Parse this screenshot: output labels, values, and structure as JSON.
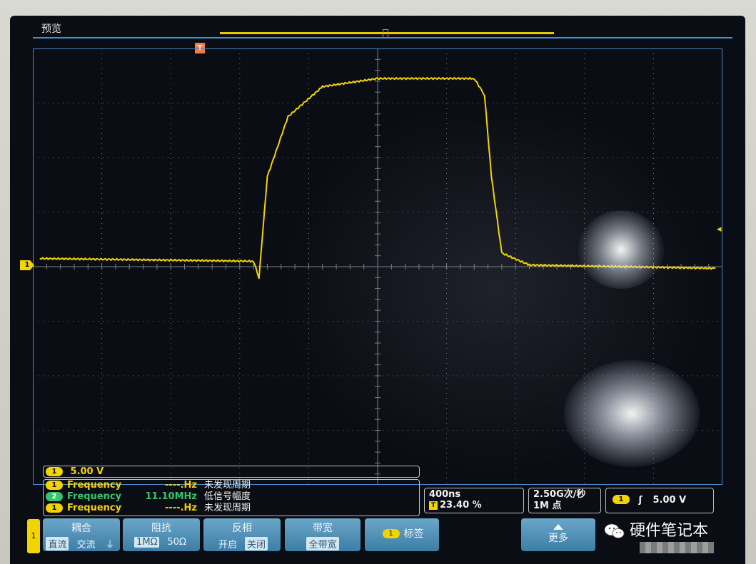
{
  "screen": {
    "title": "预览"
  },
  "markers": {
    "trigger_position": "T",
    "channel1": "1"
  },
  "scale_readout": {
    "channel": "1",
    "value": "5.00 V"
  },
  "measurements": [
    {
      "channel": "1",
      "name": "Frequency",
      "value": "----.Hz",
      "note": "未发现周期",
      "color": "#f2d400"
    },
    {
      "channel": "2",
      "name": "Frequency",
      "value": "11.10MHz",
      "note": "低信号幅度",
      "color": "#37c36a"
    },
    {
      "channel": "1",
      "name": "Frequency",
      "value": "----.Hz",
      "note": "未发现周期",
      "color": "#f2d400"
    }
  ],
  "timebase": {
    "per_div": "400ns",
    "trigger_icon": "T",
    "trigger_position": "23.40 %"
  },
  "sample": {
    "rate": "2.50G次/秒",
    "record_length": "1M 点"
  },
  "trigger": {
    "channel": "1",
    "slope_icon": "rising-edge-icon",
    "slope_glyph": "ʃ",
    "level": "5.00 V"
  },
  "softkeys": {
    "side_tab": "1",
    "coupling": {
      "title": "耦合",
      "opt1": "直流",
      "opt2": "交流",
      "opt3": "⏚"
    },
    "impedance": {
      "title": "阻抗",
      "opt1": "1MΩ",
      "opt2": "50Ω"
    },
    "invert": {
      "title": "反相",
      "opt1": "开启",
      "opt2": "关闭"
    },
    "bandwidth": {
      "title": "带宽",
      "opt1": "全带宽"
    },
    "label": {
      "badge": "1",
      "title": "标签"
    },
    "more": {
      "title": "更多"
    }
  },
  "watermark": {
    "text": "硬件笔记本"
  },
  "colors": {
    "trace": "#f2d400",
    "channel2": "#37c36a",
    "graticule": "#4a86c8",
    "softkey": "#4a8cb2"
  },
  "waveform": {
    "description_points": [
      [
        -4.9,
        0.2
      ],
      [
        -1.8,
        0.15
      ],
      [
        -1.72,
        -0.15
      ],
      [
        -1.6,
        1.7
      ],
      [
        -1.3,
        2.8
      ],
      [
        -0.8,
        3.35
      ],
      [
        0.0,
        3.5
      ],
      [
        1.4,
        3.5
      ],
      [
        1.55,
        3.2
      ],
      [
        1.65,
        1.7
      ],
      [
        1.8,
        0.3
      ],
      [
        2.2,
        0.08
      ],
      [
        4.9,
        0.02
      ]
    ],
    "x_unit": "div",
    "y_unit": "div"
  }
}
